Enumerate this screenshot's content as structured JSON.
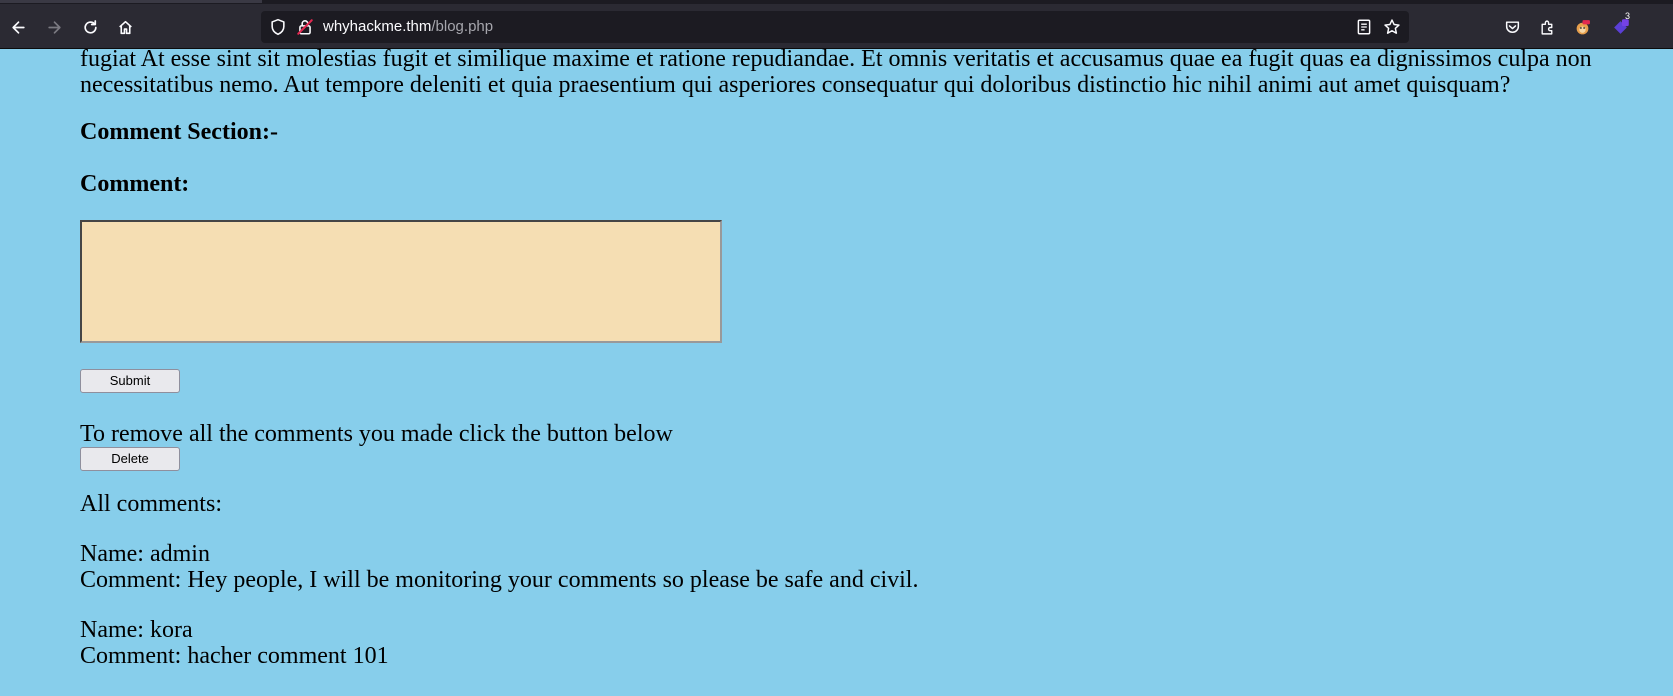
{
  "browser": {
    "url_host": "whyhackme.thm",
    "url_path": "/blog.php",
    "extensions_badge": "3"
  },
  "page": {
    "paragraph": "fugiat At esse sint sit molestias fugit et similique maxime et ratione repudiandae. Et omnis veritatis et accusamus quae ea fugit quas ea dignissimos culpa non necessitatibus nemo. Aut tempore deleniti et quia praesentium qui asperiores consequatur qui doloribus distinctio hic nihil animi aut amet quisquam?",
    "comment_section_heading": "Comment Section:-",
    "comment_label": "Comment:",
    "comment_value": "",
    "submit_label": "Submit",
    "remove_text": "To remove all the comments you made click the button below",
    "delete_label": "Delete",
    "all_comments_label": "All comments:",
    "comments": [
      {
        "name_line": "Name: admin",
        "comment_line": "Comment: Hey people, I will be monitoring your comments so please be safe and civil."
      },
      {
        "name_line": "Name: kora",
        "comment_line": "Comment: hacher comment 101"
      }
    ]
  },
  "colors": {
    "page_background": "#87ceeb",
    "textarea_background": "#f5deb3",
    "toolbar_background": "#2b2a33",
    "urlbar_background": "#1c1b22"
  }
}
